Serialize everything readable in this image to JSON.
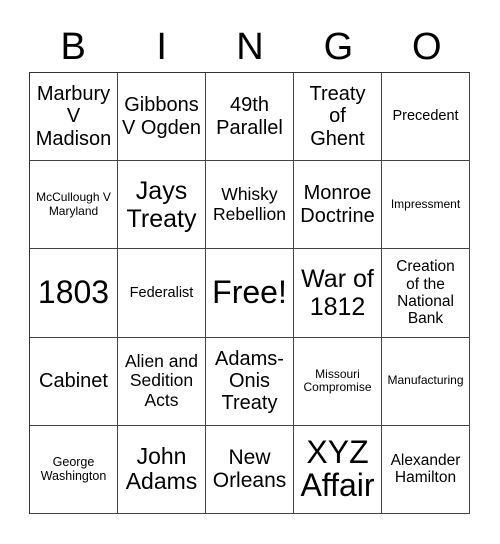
{
  "header": {
    "letters": [
      "B",
      "I",
      "N",
      "G",
      "O"
    ]
  },
  "cells": [
    "Marbury V Madison",
    "Gibbons V Ogden",
    "49th Parallel",
    "Treaty of Ghent",
    "Precedent",
    "McCullough V Maryland",
    "Jays Treaty",
    "Whisky Rebellion",
    "Monroe Doctrine",
    "Impressment",
    "1803",
    "Federalist",
    "Free!",
    "War of 1812",
    "Creation of the National Bank",
    "Cabinet",
    "Alien and Sedition Acts",
    "Adams-Onis Treaty",
    "Missouri Compromise",
    "Manufacturing",
    "George Washington",
    "John Adams",
    "New Orleans",
    "XYZ Affair",
    "Alexander Hamilton"
  ]
}
